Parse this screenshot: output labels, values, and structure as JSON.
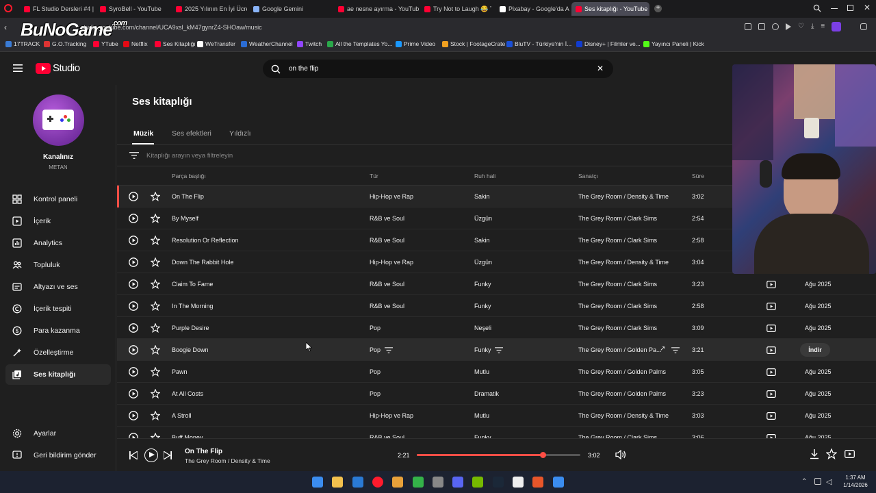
{
  "browser": {
    "tabs": [
      {
        "label": "FL Studio Dersleri #4 | Sıfır",
        "color": "#ff0033"
      },
      {
        "label": "SyroBell - YouTube",
        "color": "#ff0033"
      },
      {
        "label": "2025 Yılının En İyi Ücretsiz",
        "color": "#ff0033"
      },
      {
        "label": "Google Gemini",
        "color": "#8ab4f8"
      },
      {
        "label": "ae nesne ayırma - YouTube",
        "color": "#ff0033"
      },
      {
        "label": "Try Not to Laugh 😂 Top",
        "color": "#ff0033"
      },
      {
        "label": "Pixabay - Google'da Ara",
        "color": "#ffffff"
      },
      {
        "label": "Ses kitaplığı - YouTube St",
        "color": "#ff0033"
      }
    ],
    "url": "studio.youtube.com/channel/UCA9xsl_kM47gynrZ4-SHOaw/music",
    "watermark": "BuNoGame",
    "watermark_suffix": ".com",
    "bookmarks": [
      {
        "label": "17TRACK",
        "color": "#3a7bd5"
      },
      {
        "label": "G.O.Tracking",
        "color": "#d33"
      },
      {
        "label": "YTube",
        "color": "#ff0033"
      },
      {
        "label": "Netflix",
        "color": "#e50914"
      },
      {
        "label": "Ses Kitaplığı",
        "color": "#ff0033"
      },
      {
        "label": "WeTransfer",
        "color": "#ffffff"
      },
      {
        "label": "WeatherChannel",
        "color": "#2b6cd4"
      },
      {
        "label": "Twitch",
        "color": "#9146ff"
      },
      {
        "label": "All the Templates Yo...",
        "color": "#2aa84a"
      },
      {
        "label": "Prime Video",
        "color": "#1a98ff"
      },
      {
        "label": "Stock | FootageCrate",
        "color": "#f0a020"
      },
      {
        "label": "BluTV - Türkiye'nin İ...",
        "color": "#1a4fd6"
      },
      {
        "label": "Disney+ | Filmler ve...",
        "color": "#113ccf"
      },
      {
        "label": "Yayıncı Paneli | Kick",
        "color": "#53fc18"
      }
    ]
  },
  "studio": {
    "logo_text": "Studio",
    "search_value": "on the flip",
    "channel": {
      "name": "Kanalınız",
      "handle": "METAN"
    },
    "nav": [
      {
        "label": "Kontrol paneli",
        "icon": "dashboard-icon"
      },
      {
        "label": "İçerik",
        "icon": "content-icon"
      },
      {
        "label": "Analytics",
        "icon": "analytics-icon"
      },
      {
        "label": "Topluluk",
        "icon": "community-icon"
      },
      {
        "label": "Altyazı ve ses",
        "icon": "subtitles-icon"
      },
      {
        "label": "İçerik tespiti",
        "icon": "copyright-icon"
      },
      {
        "label": "Para kazanma",
        "icon": "monetization-icon"
      },
      {
        "label": "Özelleştirme",
        "icon": "customization-icon"
      },
      {
        "label": "Ses kitaplığı",
        "icon": "audio-library-icon"
      }
    ],
    "settings_label": "Ayarlar",
    "feedback_label": "Geri bildirim gönder",
    "page_title": "Ses kitaplığı",
    "tabs": [
      "Müzik",
      "Ses efektleri",
      "Yıldızlı"
    ],
    "filter_placeholder": "Kitaplığı arayın veya filtreleyin",
    "columns": {
      "title": "Parça başlığı",
      "genre": "Tür",
      "mood": "Ruh hali",
      "artist": "Sanatçı",
      "duration": "Süre"
    },
    "tracks": [
      {
        "title": "On The Flip",
        "genre": "Hip-Hop ve Rap",
        "mood": "Sakin",
        "artist": "The Grey Room / Density & Time",
        "duration": "3:02",
        "date": ""
      },
      {
        "title": "By Myself",
        "genre": "R&B ve Soul",
        "mood": "Üzgün",
        "artist": "The Grey Room / Clark Sims",
        "duration": "2:54",
        "date": ""
      },
      {
        "title": "Resolution Or Reflection",
        "genre": "R&B ve Soul",
        "mood": "Sakin",
        "artist": "The Grey Room / Clark Sims",
        "duration": "2:58",
        "date": ""
      },
      {
        "title": "Down The Rabbit Hole",
        "genre": "Hip-Hop ve Rap",
        "mood": "Üzgün",
        "artist": "The Grey Room / Density & Time",
        "duration": "3:04",
        "date": ""
      },
      {
        "title": "Claim To Fame",
        "genre": "R&B ve Soul",
        "mood": "Funky",
        "artist": "The Grey Room / Clark Sims",
        "duration": "3:23",
        "date": "Ağu 2025"
      },
      {
        "title": "In The Morning",
        "genre": "R&B ve Soul",
        "mood": "Funky",
        "artist": "The Grey Room / Clark Sims",
        "duration": "2:58",
        "date": "Ağu 2025"
      },
      {
        "title": "Purple Desire",
        "genre": "Pop",
        "mood": "Neşeli",
        "artist": "The Grey Room / Clark Sims",
        "duration": "3:09",
        "date": "Ağu 2025"
      },
      {
        "title": "Boogie Down",
        "genre": "Pop",
        "mood": "Funky",
        "artist": "The Grey Room / Golden Pa...",
        "duration": "3:21",
        "date": ""
      },
      {
        "title": "Pawn",
        "genre": "Pop",
        "mood": "Mutlu",
        "artist": "The Grey Room / Golden Palms",
        "duration": "3:05",
        "date": "Ağu 2025"
      },
      {
        "title": "At All Costs",
        "genre": "Pop",
        "mood": "Dramatik",
        "artist": "The Grey Room / Golden Palms",
        "duration": "3:23",
        "date": "Ağu 2025"
      },
      {
        "title": "A Stroll",
        "genre": "Hip-Hop ve Rap",
        "mood": "Mutlu",
        "artist": "The Grey Room / Density & Time",
        "duration": "3:03",
        "date": "Ağu 2025"
      },
      {
        "title": "Buff Money",
        "genre": "R&B ve Soul",
        "mood": "Funky",
        "artist": "The Grey Room / Clark Sims",
        "duration": "3:06",
        "date": "Ağu 2025"
      }
    ],
    "download_label": "İndir",
    "player": {
      "title": "On The Flip",
      "artist": "The Grey Room / Density & Time",
      "elapsed": "2:21",
      "total": "3:02",
      "progress": 0.77
    }
  },
  "taskbar": {
    "time": "1:37 AM",
    "date": "1/14/2026"
  },
  "colors": {
    "accent": "#ff4e45",
    "active_row_bar": "#ff4e45",
    "youtube_red": "#ff0033"
  }
}
